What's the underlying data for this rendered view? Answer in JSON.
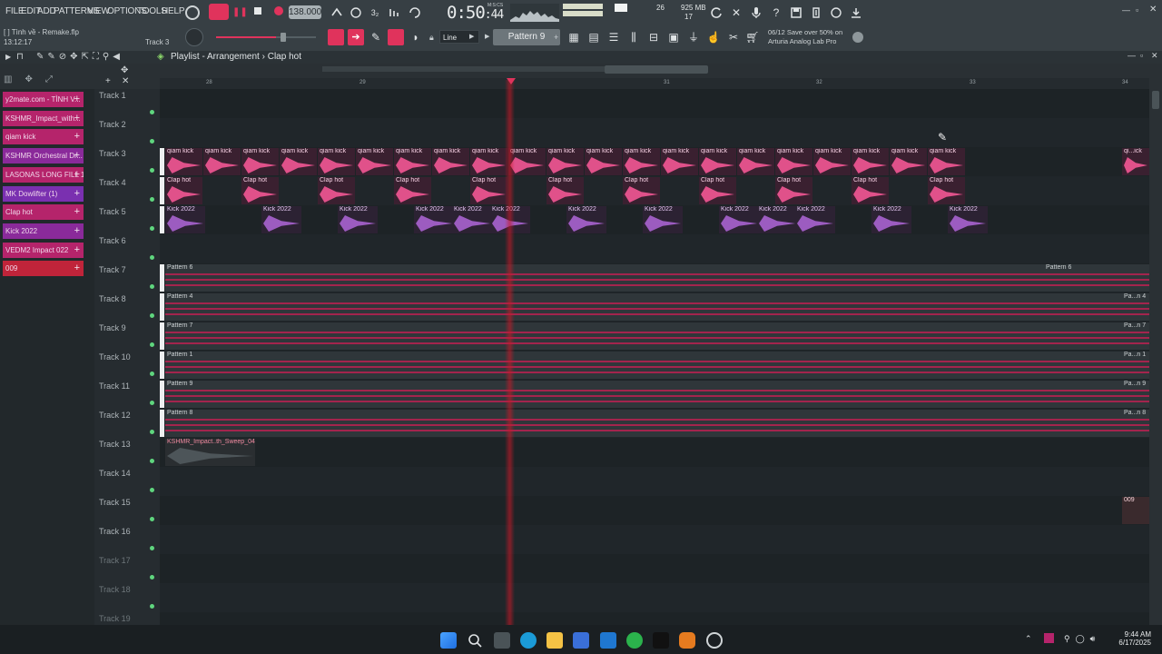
{
  "menu": [
    "FILE",
    "EDIT",
    "ADD",
    "PATTERNS",
    "VIEW",
    "OPTIONS",
    "TOOLS",
    "HELP"
  ],
  "project": {
    "file": "[ ] Tình về - Remake.flp",
    "elapsed": "13:12:17",
    "track_hint": "Track 3"
  },
  "transport": {
    "tempo": "138.000",
    "time": "0:50",
    "time_frac": ":44",
    "time_caption": "M:S:CS"
  },
  "cpu": {
    "value": "26",
    "mem": "925 MB",
    "poly": "17"
  },
  "tools": {
    "snap": "Line",
    "pattern": "Pattern 9"
  },
  "news": {
    "line1": "06/12  Save over 50% on",
    "line2": "Arturia Analog Lab Pro"
  },
  "playlist": {
    "title": "Playlist - Arrangement",
    "separator": "›",
    "current": "Clap hot"
  },
  "ruler": {
    "marks": [
      "28",
      "29",
      "31",
      "32",
      "33",
      "34"
    ]
  },
  "channels": [
    {
      "name": "y2mate.com - TÌNH V...",
      "color": "#b5246b"
    },
    {
      "name": "KSHMR_Impact_with...",
      "color": "#b5246b"
    },
    {
      "name": "qiam kick",
      "color": "#b5246b"
    },
    {
      "name": "KSHMR Orchestral Dr...",
      "color": "#8a2a9a"
    },
    {
      "name": "LASONAS LONG FILL 1",
      "color": "#b5246b"
    },
    {
      "name": "MK Dowlifter (1)",
      "color": "#7a30b0"
    },
    {
      "name": "Clap hot",
      "color": "#b5246b"
    },
    {
      "name": "Kick 2022",
      "color": "#8a2a9a"
    },
    {
      "name": "VEDM2 Impact 022",
      "color": "#b5246b"
    },
    {
      "name": "009",
      "color": "#c0243a"
    }
  ],
  "tracks": [
    "Track 1",
    "Track 2",
    "Track 3",
    "Track 4",
    "Track 5",
    "Track 6",
    "Track 7",
    "Track 8",
    "Track 9",
    "Track 10",
    "Track 11",
    "Track 12",
    "Track 13",
    "Track 14",
    "Track 15",
    "Track 16",
    "Track 17",
    "Track 18",
    "Track 19"
  ],
  "clips": {
    "track3": "qiam kick",
    "track3_tail": "qi...ick",
    "track4": "Clap hot",
    "track5": "Kick 2022",
    "track7": "Pattern 6",
    "track7b": "Pattern 6",
    "track8": "Pattern 4",
    "track8b": "Pa...n 4",
    "track9": "Pattern 7",
    "track9b": "Pa...n 7",
    "track10": "Pattern 1",
    "track10b": "Pa...n 1",
    "track11": "Pattern 9",
    "track11b": "Pa...n 9",
    "track12": "Pattern 8",
    "track12b": "Pa...n 8",
    "track13": "KSHMR_Impact..th_Sweep_04",
    "track15": "009"
  },
  "taskbar": {
    "time": "9:44 AM",
    "date": "6/17/2025"
  }
}
